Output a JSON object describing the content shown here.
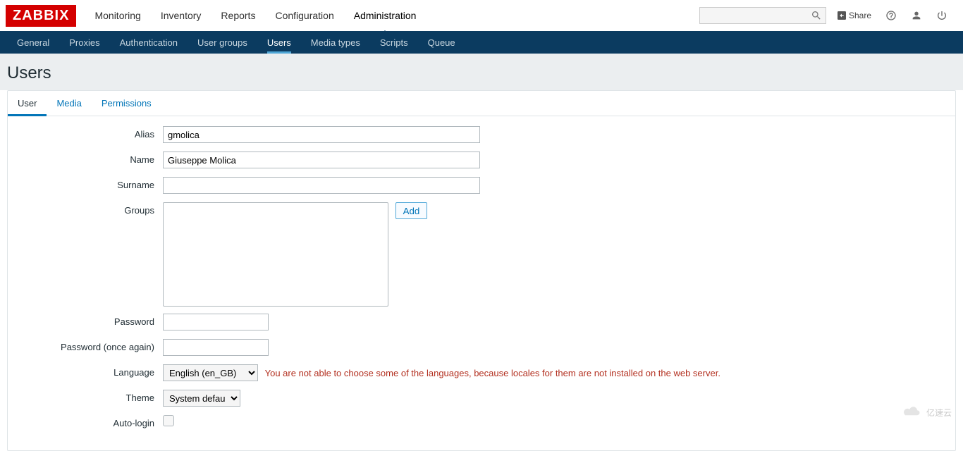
{
  "brand": "ZABBIX",
  "topnav": {
    "items": [
      {
        "label": "Monitoring"
      },
      {
        "label": "Inventory"
      },
      {
        "label": "Reports"
      },
      {
        "label": "Configuration"
      },
      {
        "label": "Administration",
        "active": true
      }
    ],
    "search_placeholder": "",
    "share_label": "Share"
  },
  "subnav": {
    "items": [
      {
        "label": "General"
      },
      {
        "label": "Proxies"
      },
      {
        "label": "Authentication"
      },
      {
        "label": "User groups"
      },
      {
        "label": "Users",
        "active": true
      },
      {
        "label": "Media types"
      },
      {
        "label": "Scripts"
      },
      {
        "label": "Queue"
      }
    ]
  },
  "page": {
    "title": "Users"
  },
  "tabs": [
    {
      "label": "User",
      "active": true
    },
    {
      "label": "Media"
    },
    {
      "label": "Permissions"
    }
  ],
  "form": {
    "alias": {
      "label": "Alias",
      "value": "gmolica"
    },
    "name": {
      "label": "Name",
      "value": "Giuseppe Molica"
    },
    "surname": {
      "label": "Surname",
      "value": ""
    },
    "groups": {
      "label": "Groups",
      "add_label": "Add"
    },
    "password": {
      "label": "Password",
      "value": ""
    },
    "password2": {
      "label": "Password (once again)",
      "value": ""
    },
    "language": {
      "label": "Language",
      "value": "English (en_GB)",
      "warning": "You are not able to choose some of the languages, because locales for them are not installed on the web server."
    },
    "theme": {
      "label": "Theme",
      "value": "System default"
    },
    "autologin": {
      "label": "Auto-login",
      "checked": false
    }
  },
  "watermark": "亿速云"
}
